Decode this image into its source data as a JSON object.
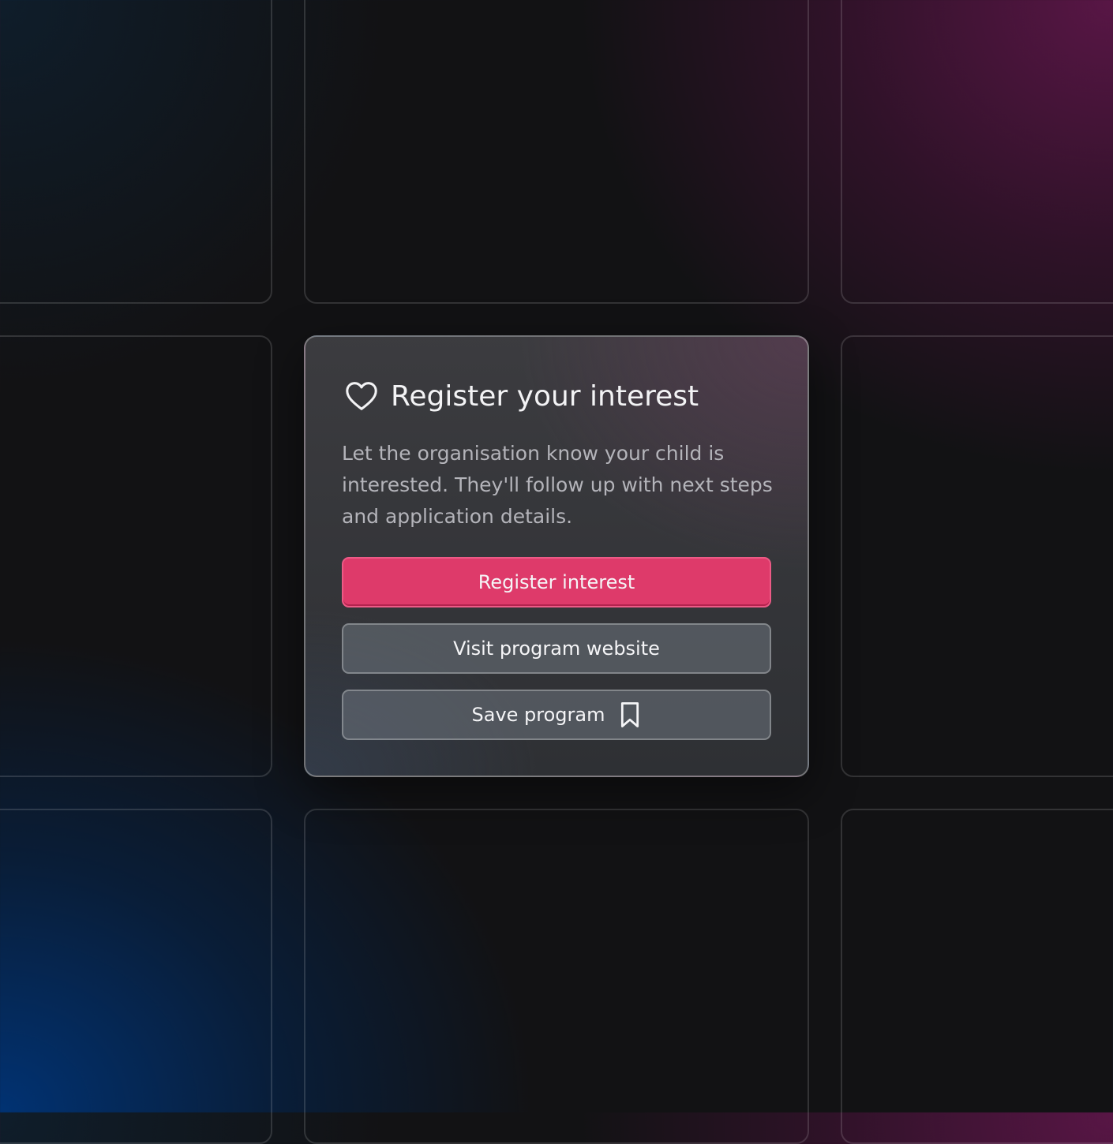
{
  "card": {
    "title": "Register your interest",
    "description": "Let the organisation know your child is interested. They'll follow up with next steps and application details.",
    "icon": "heart-icon"
  },
  "buttons": {
    "register_label": "Register interest",
    "visit_label": "Visit program website",
    "save_label": "Save program",
    "save_icon": "bookmark-icon"
  },
  "colors": {
    "primary": "#de3a6a",
    "background_blue": "#00347a",
    "background_magenta": "#5c1648"
  }
}
